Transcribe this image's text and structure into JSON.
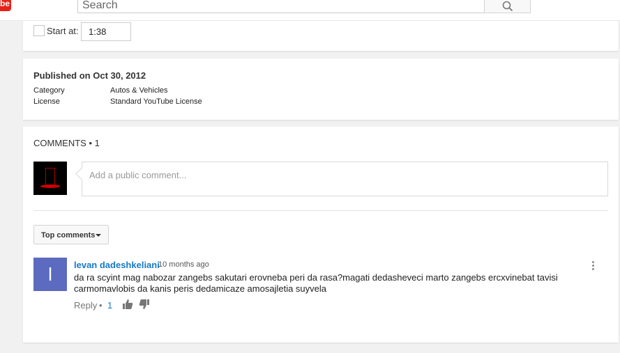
{
  "masthead": {
    "logo_text": "be",
    "search_placeholder": "Search"
  },
  "share": {
    "start_at_label": "Start at:",
    "start_at_value": "1:38"
  },
  "details": {
    "published": "Published on Oct 30, 2012",
    "category_key": "Category",
    "category_value": "Autos & Vehicles",
    "license_key": "License",
    "license_value": "Standard YouTube License"
  },
  "comments": {
    "header": "COMMENTS • 1",
    "input_placeholder": "Add a public comment...",
    "sort_label": "Top comments",
    "items": [
      {
        "avatar_letter": "l",
        "author": "levan dadeshkeliani",
        "time": "10 months ago",
        "text": "da ra scyint mag nabozar zangebs sakutari erovneba peri da rasa?magati dedasheveci marto zangebs ercxvinebat tavisi carmomavlobis da kanis peris dedamicaze amosajletia suyvela",
        "reply_label": "Reply",
        "separator": "•",
        "likes": "1"
      }
    ]
  },
  "colors": {
    "brand_red": "#e62117",
    "link_blue": "#167ac6",
    "avatar_bg": "#5c6bc0"
  },
  "icons": [
    "search-icon",
    "checkbox-icon",
    "caret-down-icon",
    "thumbs-up-icon",
    "thumbs-down-icon",
    "more-vert-icon"
  ]
}
